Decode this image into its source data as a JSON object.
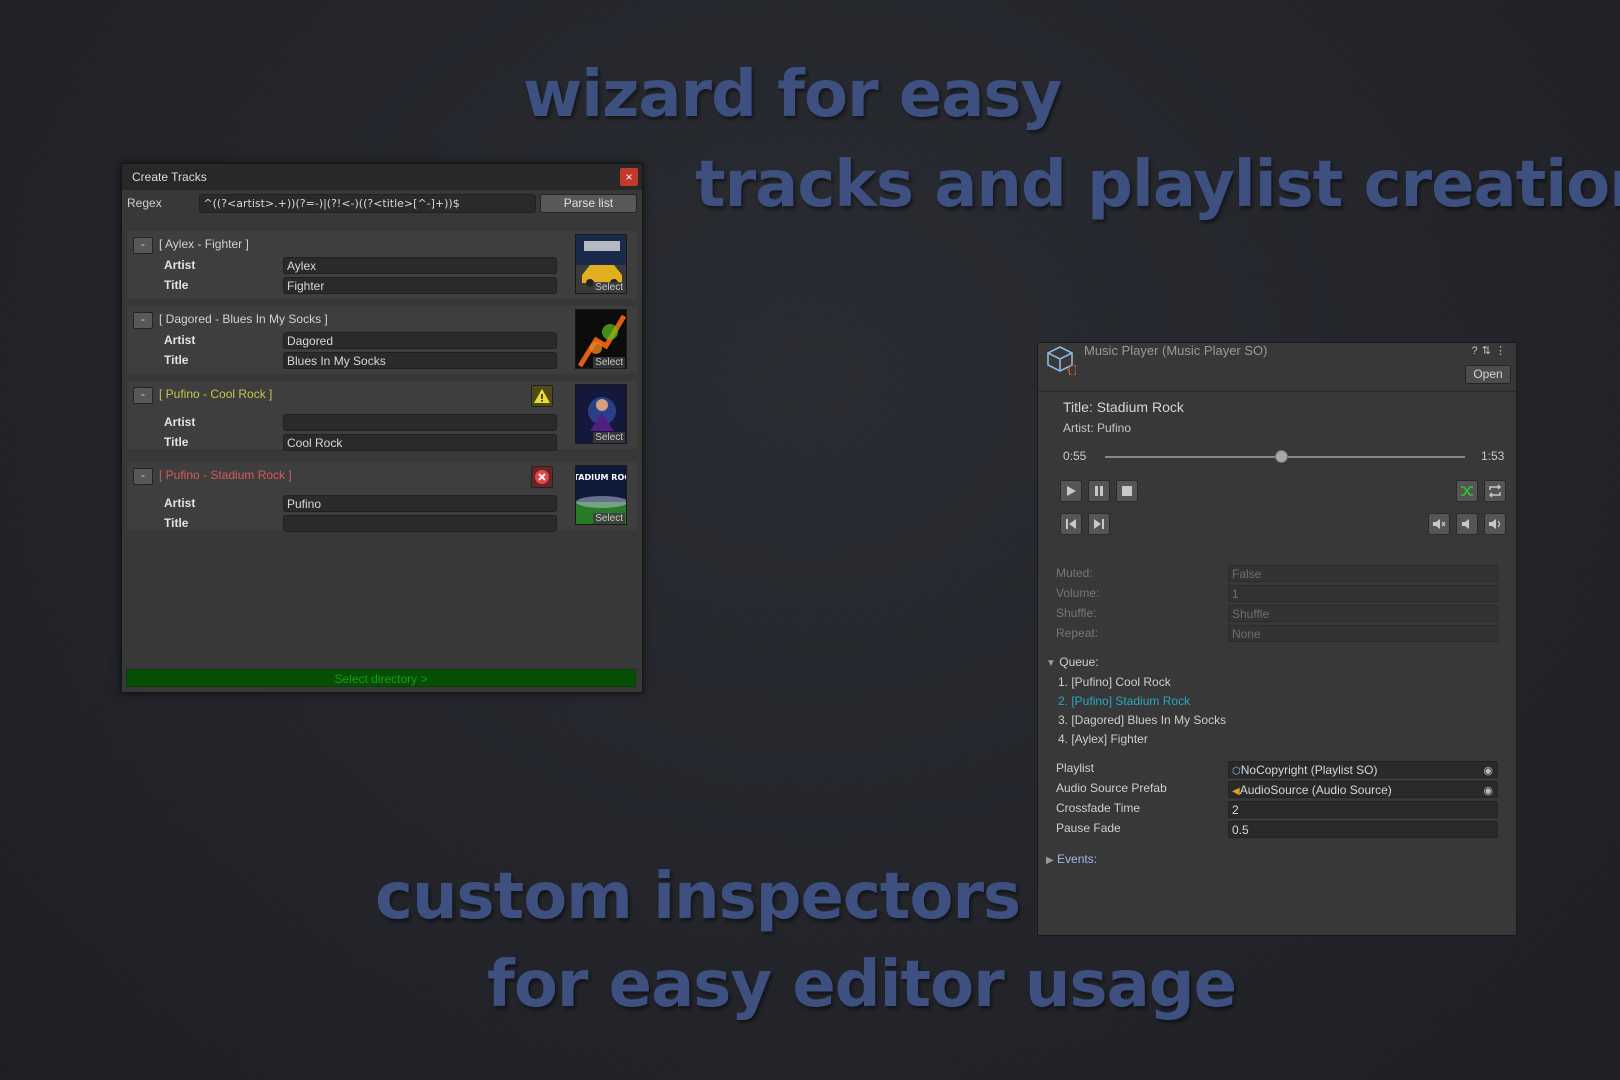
{
  "headlines": {
    "line1": "wizard for easy",
    "line2": "tracks and playlist creation",
    "line3": "custom inspectors",
    "line4": "for easy editor usage"
  },
  "create_tracks": {
    "title": "Create Tracks",
    "close_label": "×",
    "regex_label": "Regex",
    "regex_value": "^((?<artist>.+))(?=-)|(?!<-)((?<title>[^-]+))$",
    "parse_button": "Parse list",
    "artist_label": "Artist",
    "title_label": "Title",
    "remove_label": "-",
    "select_label": "Select",
    "tracks": [
      {
        "name": "[ Aylex - Fighter ]",
        "artist": "Aylex",
        "title": "Fighter",
        "status": "ok",
        "name_color": "#d2d2d2"
      },
      {
        "name": "[ Dagored - Blues In My Socks ]",
        "artist": "Dagored",
        "title": "Blues In My Socks",
        "status": "ok",
        "name_color": "#d2d2d2"
      },
      {
        "name": "[ Pufino - Cool Rock ]",
        "artist": "",
        "title": "Cool Rock",
        "status": "warning",
        "name_color": "#c8c44a"
      },
      {
        "name": "[ Pufino - Stadium Rock ]",
        "artist": "Pufino",
        "title": "",
        "status": "error",
        "name_color": "#d65a5a"
      }
    ],
    "cover_text_stadium": "STADIUM ROCK",
    "select_directory": "Select directory >"
  },
  "music_player": {
    "header_title": "Music Player (Music Player SO)",
    "open_button": "Open",
    "now_playing_title": "Title: Stadium Rock",
    "now_playing_artist": "Artist: Pufino",
    "current_time": "0:55",
    "total_time": "1:53",
    "progress": 0.49,
    "props": [
      {
        "label": "Muted:",
        "value": "False"
      },
      {
        "label": "Volume:",
        "value": "1"
      },
      {
        "label": "Shuffle:",
        "value": "Shuffle"
      },
      {
        "label": "Repeat:",
        "value": "None"
      }
    ],
    "queue_label": "Queue:",
    "queue": [
      "1. [Pufino] Cool Rock",
      "2. [Pufino] Stadium Rock",
      "3. [Dagored] Blues In My Socks",
      "4. [Aylex] Fighter"
    ],
    "queue_active_index": 1,
    "fields": [
      {
        "label": "Playlist",
        "value": "NoCopyright (Playlist SO)"
      },
      {
        "label": "Audio Source Prefab",
        "value": "AudioSource (Audio Source)"
      },
      {
        "label": "Crossfade Time",
        "value": "2"
      },
      {
        "label": "Pause Fade",
        "value": "0.5"
      }
    ],
    "events_label": "Events:"
  },
  "colors": {
    "headline": "#3d5080",
    "accent_green": "#055005",
    "queue_active": "#28a8c4"
  }
}
